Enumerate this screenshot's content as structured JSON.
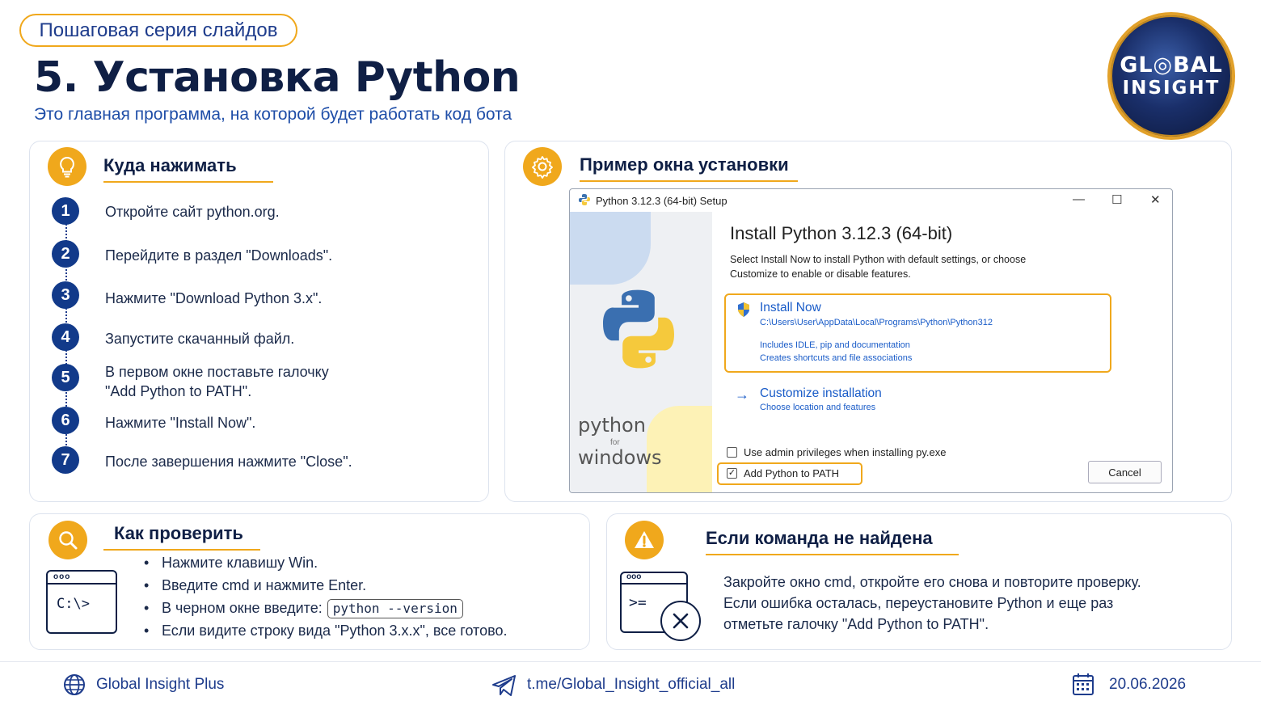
{
  "header": {
    "series_label": "Пошаговая серия слайдов",
    "title": "5.  Установка Python",
    "subtitle": "Это главная программа, на которой будет работать код бота",
    "logo_line1": "GL◎BAL",
    "logo_line2": "INSIGHT"
  },
  "where_to_click": {
    "title": "Куда нажимать",
    "steps": [
      {
        "num": "1",
        "text": "Откройте сайт python.org."
      },
      {
        "num": "2",
        "text": "Перейдите в раздел \"Downloads\"."
      },
      {
        "num": "3",
        "text": "Нажмите \"Download Python 3.x\"."
      },
      {
        "num": "4",
        "text": "Запустите скачанный файл."
      },
      {
        "num": "5",
        "text": "В первом окне поставьте галочку"
      },
      {
        "num": "6",
        "text": "Нажмите \"Install Now\"."
      },
      {
        "num": "7",
        "text": "После завершения нажмите \"Close\"."
      }
    ],
    "step5_line2": "\"Add Python to PATH\"."
  },
  "installer_example": {
    "title": "Пример окна установки",
    "window_title": "Python 3.12.3 (64-bit) Setup",
    "main_title": "Install Python 3.12.3 (64-bit)",
    "desc_line1": "Select Install Now to install Python with default settings, or choose",
    "desc_line2": "Customize to enable or disable features.",
    "install_now": "Install Now",
    "install_path": "C:\\Users\\User\\AppData\\Local\\Programs\\Python\\Python312",
    "install_info1": "Includes IDLE, pip and documentation",
    "install_info2": "Creates shortcuts and file associations",
    "customize": "Customize installation",
    "customize_sub": "Choose location and features",
    "admin_checkbox": "Use admin privileges when installing py.exe",
    "path_checkbox": "Add Python to PATH",
    "cancel": "Cancel",
    "side_python": "python",
    "side_for": "for",
    "side_windows": "windows",
    "ctrl_min": "—",
    "ctrl_max": "☐",
    "ctrl_close": "✕"
  },
  "how_to_check": {
    "title": "Как проверить",
    "prompt": "C:\\>",
    "dots": "ooo",
    "bullet1": "Нажмите клавишу Win.",
    "bullet2": "Введите cmd и нажмите Enter.",
    "bullet3": "В черном окне введите:",
    "bullet3_code": "python --version",
    "bullet4": "Если видите строку вида \"Python 3.x.x\", все готово."
  },
  "not_found": {
    "title": "Если команда не найдена",
    "line1": "Закройте окно cmd, откройте его снова и повторите проверку.",
    "line2": "Если ошибка осталась, переустановите Python и еще раз",
    "line3": "отметьте галочку \"Add Python to PATH\".",
    "prompt": ">="
  },
  "footer": {
    "brand": "Global Insight Plus",
    "telegram": "t.me/Global_Insight_official_all",
    "date": "20.06.2026"
  },
  "colors": {
    "accent": "#f0a81c",
    "navy": "#0f1f45",
    "blue": "#1e3c8c",
    "link": "#1a5cc8"
  }
}
